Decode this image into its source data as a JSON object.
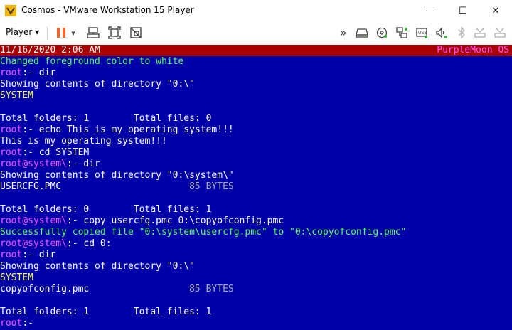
{
  "window": {
    "title": "Cosmos - VMware Workstation 15 Player",
    "minimize_glyph": "—",
    "maximize_glyph": "☐",
    "close_glyph": "✕"
  },
  "toolbar": {
    "player_menu": "Player",
    "player_arrow": "▾",
    "pause_arrow": "▾",
    "more_glyph": "»",
    "icons": [
      "pause-icon",
      "send-ctrl-alt-del-icon",
      "fit-guest-icon",
      "unity-icon",
      "hard-disk-icon",
      "cd-dvd-icon",
      "network-adapter-icon",
      "usb-controller-icon",
      "sound-card-icon",
      "bluetooth-icon",
      "printer-icon",
      "display-icon"
    ]
  },
  "console": {
    "status": {
      "datetime": "11/16/2020 2:06 AM",
      "os_name": "PurpleMoon OS"
    },
    "colors": {
      "background": "#0000a8",
      "status_bar": "#a80000",
      "green": "#55ff55",
      "magenta": "#ff55ff",
      "yellow": "#ffff55",
      "white": "#ffffff",
      "gray": "#aaaaaa"
    },
    "lines": [
      [
        {
          "t": "Changed foreground color to white",
          "c": "green"
        }
      ],
      [
        {
          "t": "root",
          "c": "magenta"
        },
        {
          "t": ":- dir",
          "c": "white"
        }
      ],
      [
        {
          "t": "Showing contents of directory \"0:\\\"",
          "c": "white"
        }
      ],
      [
        {
          "t": "SYSTEM",
          "c": "yellow"
        }
      ],
      [],
      [
        {
          "t": "Total folders: 1        Total files: 0",
          "c": "white"
        }
      ],
      [
        {
          "t": "root",
          "c": "magenta"
        },
        {
          "t": ":- echo This is my operating system!!!",
          "c": "white"
        }
      ],
      [
        {
          "t": "This is my operating system!!!",
          "c": "white"
        }
      ],
      [
        {
          "t": "root",
          "c": "magenta"
        },
        {
          "t": ":- cd SYSTEM",
          "c": "white"
        }
      ],
      [
        {
          "t": "root@system\\",
          "c": "magenta"
        },
        {
          "t": ":- dir",
          "c": "white"
        }
      ],
      [
        {
          "t": "Showing contents of directory \"0:\\system\\\"",
          "c": "white"
        }
      ],
      [
        {
          "t": "USERCFG.PMC                       ",
          "c": "white"
        },
        {
          "t": "85 BYTES",
          "c": "gray"
        }
      ],
      [],
      [
        {
          "t": "Total folders: 0        Total files: 1",
          "c": "white"
        }
      ],
      [
        {
          "t": "root@system\\",
          "c": "magenta"
        },
        {
          "t": ":- copy usercfg.pmc 0:\\copyofconfig.pmc",
          "c": "white"
        }
      ],
      [
        {
          "t": "Successfully copied file \"0:\\system\\usercfg.pmc\" to \"0:\\copyofconfig.pmc\"",
          "c": "green"
        }
      ],
      [
        {
          "t": "root@system\\",
          "c": "magenta"
        },
        {
          "t": ":- cd 0:",
          "c": "white"
        }
      ],
      [
        {
          "t": "root",
          "c": "magenta"
        },
        {
          "t": ":- dir",
          "c": "white"
        }
      ],
      [
        {
          "t": "Showing contents of directory \"0:\\\"",
          "c": "white"
        }
      ],
      [
        {
          "t": "SYSTEM",
          "c": "yellow"
        }
      ],
      [
        {
          "t": "copyofconfig.pmc                  ",
          "c": "white"
        },
        {
          "t": "85 BYTES",
          "c": "gray"
        }
      ],
      [],
      [
        {
          "t": "Total folders: 1        Total files: 1",
          "c": "white"
        }
      ],
      [
        {
          "t": "root",
          "c": "magenta"
        },
        {
          "t": ":-",
          "c": "white"
        }
      ]
    ]
  }
}
